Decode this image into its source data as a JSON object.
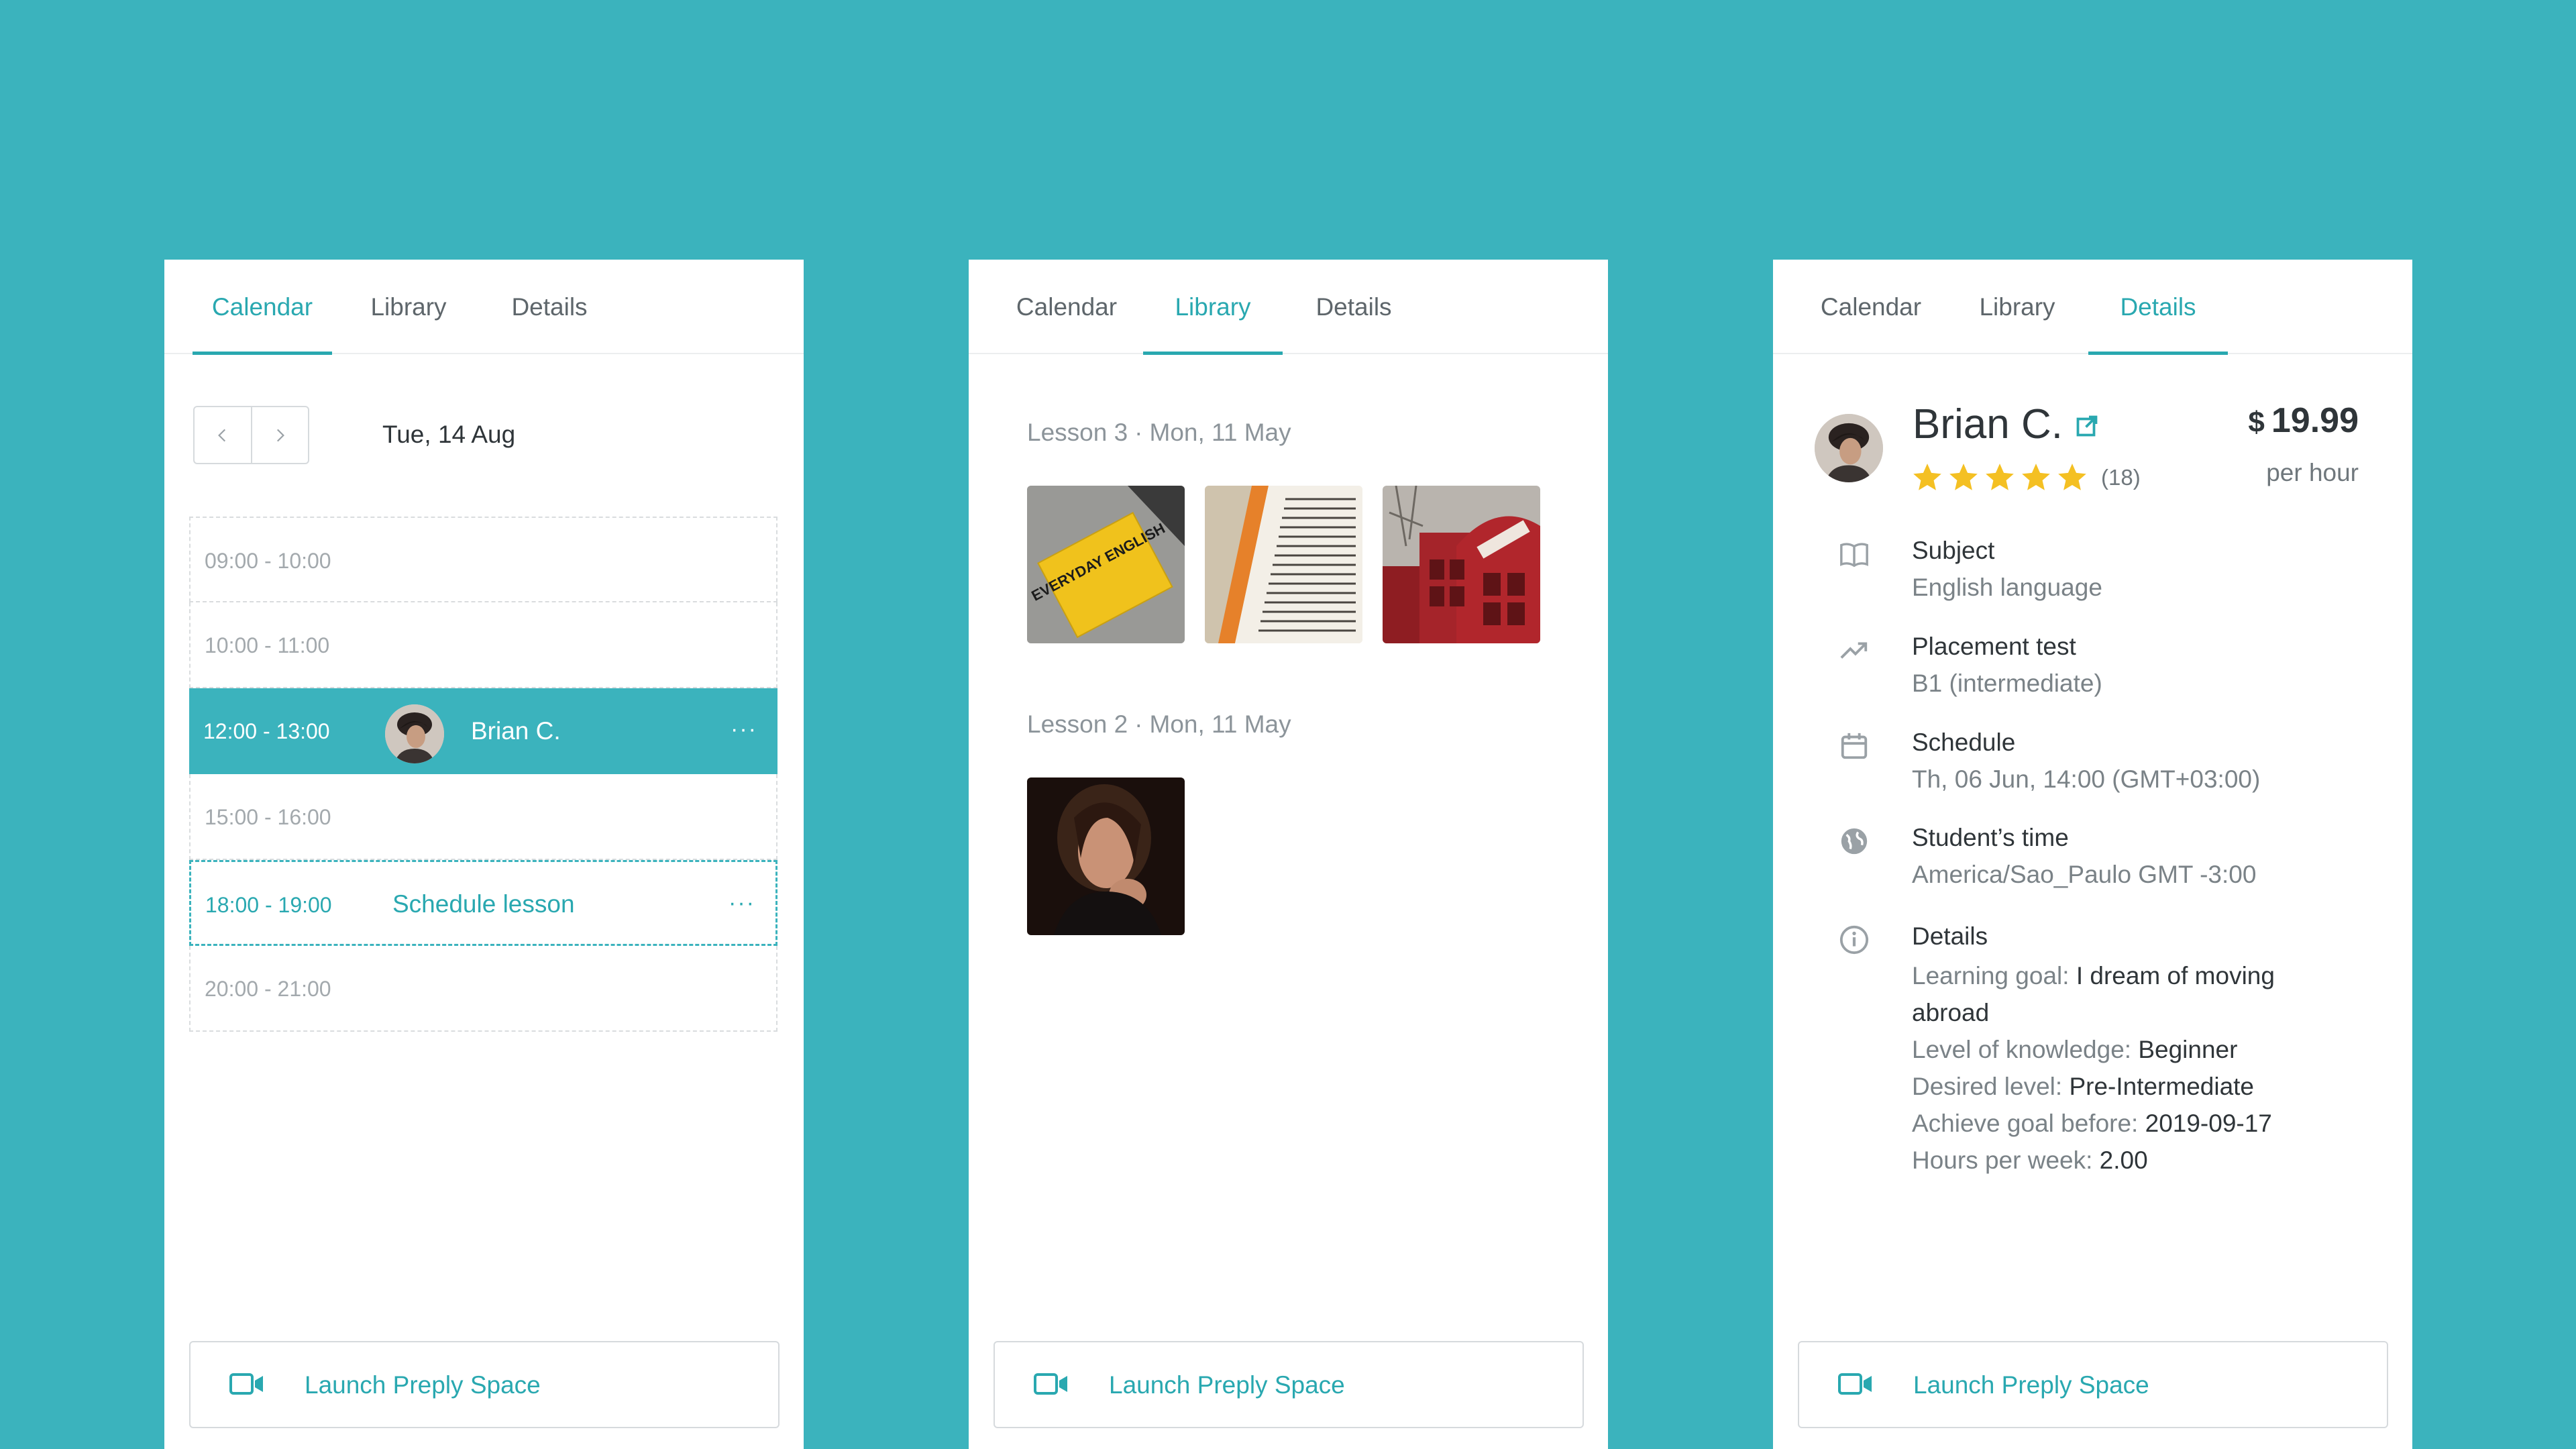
{
  "tabs": [
    "Calendar",
    "Library",
    "Details"
  ],
  "calendar": {
    "date": "Tue, 14 Aug",
    "slots": [
      {
        "time": "09:00 - 10:00"
      },
      {
        "time": "10:00 - 11:00"
      },
      {
        "time": "12:00 - 13:00",
        "student": "Brian C.",
        "menu": "···"
      },
      {
        "time": "15:00 - 16:00"
      },
      {
        "time": "18:00 - 19:00",
        "action": "Schedule lesson",
        "menu": "···"
      },
      {
        "time": "20:00 - 21:00"
      }
    ]
  },
  "library": {
    "lessons": [
      {
        "lesson": "Lesson 3",
        "sep": "·",
        "date": "Mon, 11 May",
        "images": [
          "everyday-english-book",
          "open-book-pages",
          "red-telephone-booths"
        ]
      },
      {
        "lesson": "Lesson 2",
        "sep": "·",
        "date": "Mon, 11 May",
        "images": [
          "woman-portrait"
        ]
      }
    ],
    "book_cover_text": "EVERYDAY ENGLISH"
  },
  "details": {
    "name": "Brian C.",
    "rating": 5,
    "reviews": "(18)",
    "currency": "$",
    "price": "19.99",
    "per": "per hour",
    "rows": [
      {
        "title": "Subject",
        "value": "English language",
        "icon": "book-icon"
      },
      {
        "title": "Placement test",
        "value": "B1 (intermediate)",
        "icon": "trend-up-icon"
      },
      {
        "title": "Schedule",
        "value": "Th, 06 Jun, 14:00 (GMT+03:00)",
        "icon": "calendar-icon"
      },
      {
        "title": "Student’s time",
        "value": "America/Sao_Paulo GMT -3:00",
        "icon": "globe-icon"
      },
      {
        "title": "Details",
        "icon": "info-icon"
      }
    ],
    "goal_label": "Learning goal:",
    "goal_value": "I dream of moving abroad",
    "knowledge_label": "Level of knowledge:",
    "knowledge_value": "Beginner",
    "desired_label": "Desired level:",
    "desired_value": "Pre-Intermediate",
    "achieve_label": "Achieve goal before:",
    "achieve_value": "2019-09-17",
    "hours_label": "Hours per week:",
    "hours_value": "2.00"
  },
  "launch_label": "Launch Preply Space",
  "colors": {
    "background": "#3bb3bd",
    "accent": "#29a8b0",
    "star": "#f4c023"
  }
}
